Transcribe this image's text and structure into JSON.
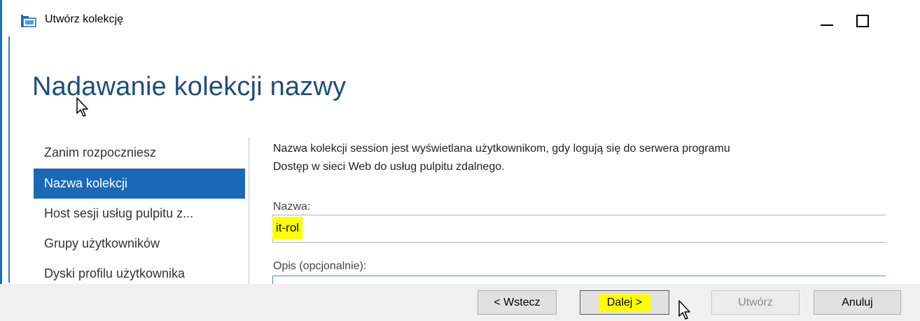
{
  "window": {
    "title": "Utwórz kolekcję",
    "icon": "collection-wizard-icon",
    "controls": [
      "minimize",
      "maximize"
    ]
  },
  "page": {
    "title": "Nadawanie kolekcji nazwy"
  },
  "nav": {
    "items": [
      {
        "label": "Zanim rozpoczniesz",
        "active": false
      },
      {
        "label": "Nazwa kolekcji",
        "active": true
      },
      {
        "label": "Host sesji usług pulpitu z...",
        "active": false
      },
      {
        "label": "Grupy użytkowników",
        "active": false
      },
      {
        "label": "Dyski profilu użytkownika",
        "active": false
      }
    ]
  },
  "content": {
    "description_line1": "Nazwa kolekcji session jest wyświetlana użytkownikom, gdy logują się do serwera programu",
    "description_line2": "Dostęp w sieci Web do usług pulpitu zdalnego.",
    "name_label": "Nazwa:",
    "name_value": "it-rol",
    "description_label": "Opis (opcjonalnie):",
    "description_value": ""
  },
  "footer": {
    "back_label": "< Wstecz",
    "next_label": "Dalej >",
    "create_label": "Utwórz",
    "cancel_label": "Anuluj",
    "create_disabled": true
  },
  "colors": {
    "accent": "#1a69b7",
    "title": "#1e4e79",
    "highlight": "#ffff00"
  }
}
